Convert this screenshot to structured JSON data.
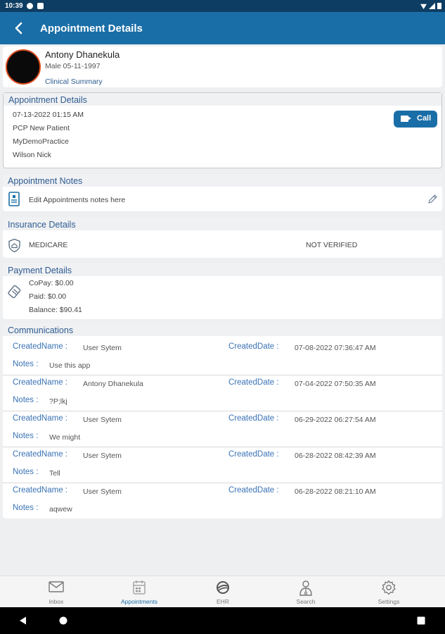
{
  "status": {
    "time": "10:39"
  },
  "appbar": {
    "title": "Appointment Details"
  },
  "patient": {
    "name": "Antony Dhanekula",
    "info": "Male 05-11-1997",
    "clinical_summary": "Clinical Summary"
  },
  "appointment": {
    "heading": "Appointment Details",
    "datetime": "07-13-2022 01:15 AM",
    "type": "PCP New Patient",
    "practice": "MyDemoPractice",
    "provider": "Wilson Nick",
    "call_label": "Call"
  },
  "notes": {
    "heading": "Appointment Notes",
    "text": "Edit Appointments notes here"
  },
  "insurance": {
    "heading": "Insurance Details",
    "name": "MEDICARE",
    "status": "NOT VERIFIED"
  },
  "payment": {
    "heading": "Payment Details",
    "copay": "CoPay: $0.00",
    "paid": "Paid: $0.00",
    "balance": "Balance: $90.41"
  },
  "communications": {
    "heading": "Communications",
    "name_label": "CreatedName :",
    "date_label": "CreatedDate :",
    "notes_label": "Notes :",
    "entries": [
      {
        "name": "User Sytem",
        "date": "07-08-2022 07:36:47 AM",
        "notes": "Use this app"
      },
      {
        "name": "Antony Dhanekula",
        "date": "07-04-2022 07:50:35 AM",
        "notes": "?P;lkj"
      },
      {
        "name": "User Sytem",
        "date": "06-29-2022 06:27:54 AM",
        "notes": "We might"
      },
      {
        "name": "User Sytem",
        "date": "06-28-2022 08:42:39 AM",
        "notes": "Tell"
      },
      {
        "name": "User Sytem",
        "date": "06-28-2022 08:21:10 AM",
        "notes": "aqwew"
      }
    ]
  },
  "bottom_nav": [
    {
      "label": "Inbox",
      "icon": "mail-icon"
    },
    {
      "label": "Appointments",
      "icon": "calendar-icon",
      "active": true
    },
    {
      "label": "EHR",
      "icon": "ehr-logo-icon"
    },
    {
      "label": "Search",
      "icon": "doctor-search-icon"
    },
    {
      "label": "Settings",
      "icon": "gear-icon"
    }
  ],
  "colors": {
    "primary": "#1a6ea7",
    "status_bar": "#0e3d63",
    "section_heading": "#2e5c91",
    "link": "#3a73b5"
  }
}
